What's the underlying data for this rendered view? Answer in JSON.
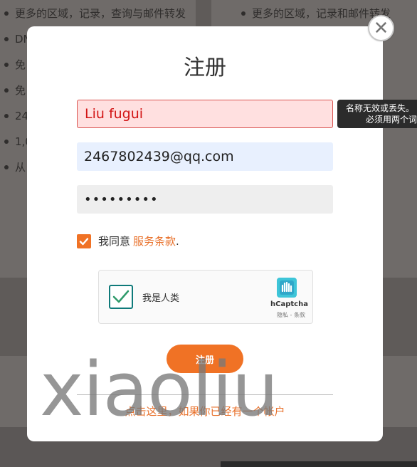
{
  "background": {
    "left_items": [
      "更多的区域，记录，查询与邮件转发",
      "DN",
      "免",
      "免",
      "24",
      "1,0",
      "从"
    ],
    "right_items": [
      "更多的区域，记录和邮件转发"
    ]
  },
  "modal": {
    "close_symbol": "✕",
    "title": "注册",
    "name_value": "Liu  fugui",
    "email_value": "2467802439@qq.com",
    "password_value": "•••••••••",
    "error_tooltip": {
      "line1": "名称无效或丢失。",
      "line2": "必须用两个词"
    },
    "agree_text": "我同意",
    "terms_link": "服务条款",
    "terms_period": ".",
    "captcha": {
      "label": "我是人类",
      "brand": "hCaptcha",
      "terms": "隐私 - 条款"
    },
    "submit_label": "注册",
    "login_link": "点击这里，如果你已经有一个帐户"
  },
  "watermark": "xiaoliu",
  "colors": {
    "accent": "#f07225",
    "error_bg": "#ffe0e0",
    "autofill_bg": "#e8f0fe",
    "captcha_teal": "#0f7a7a"
  }
}
